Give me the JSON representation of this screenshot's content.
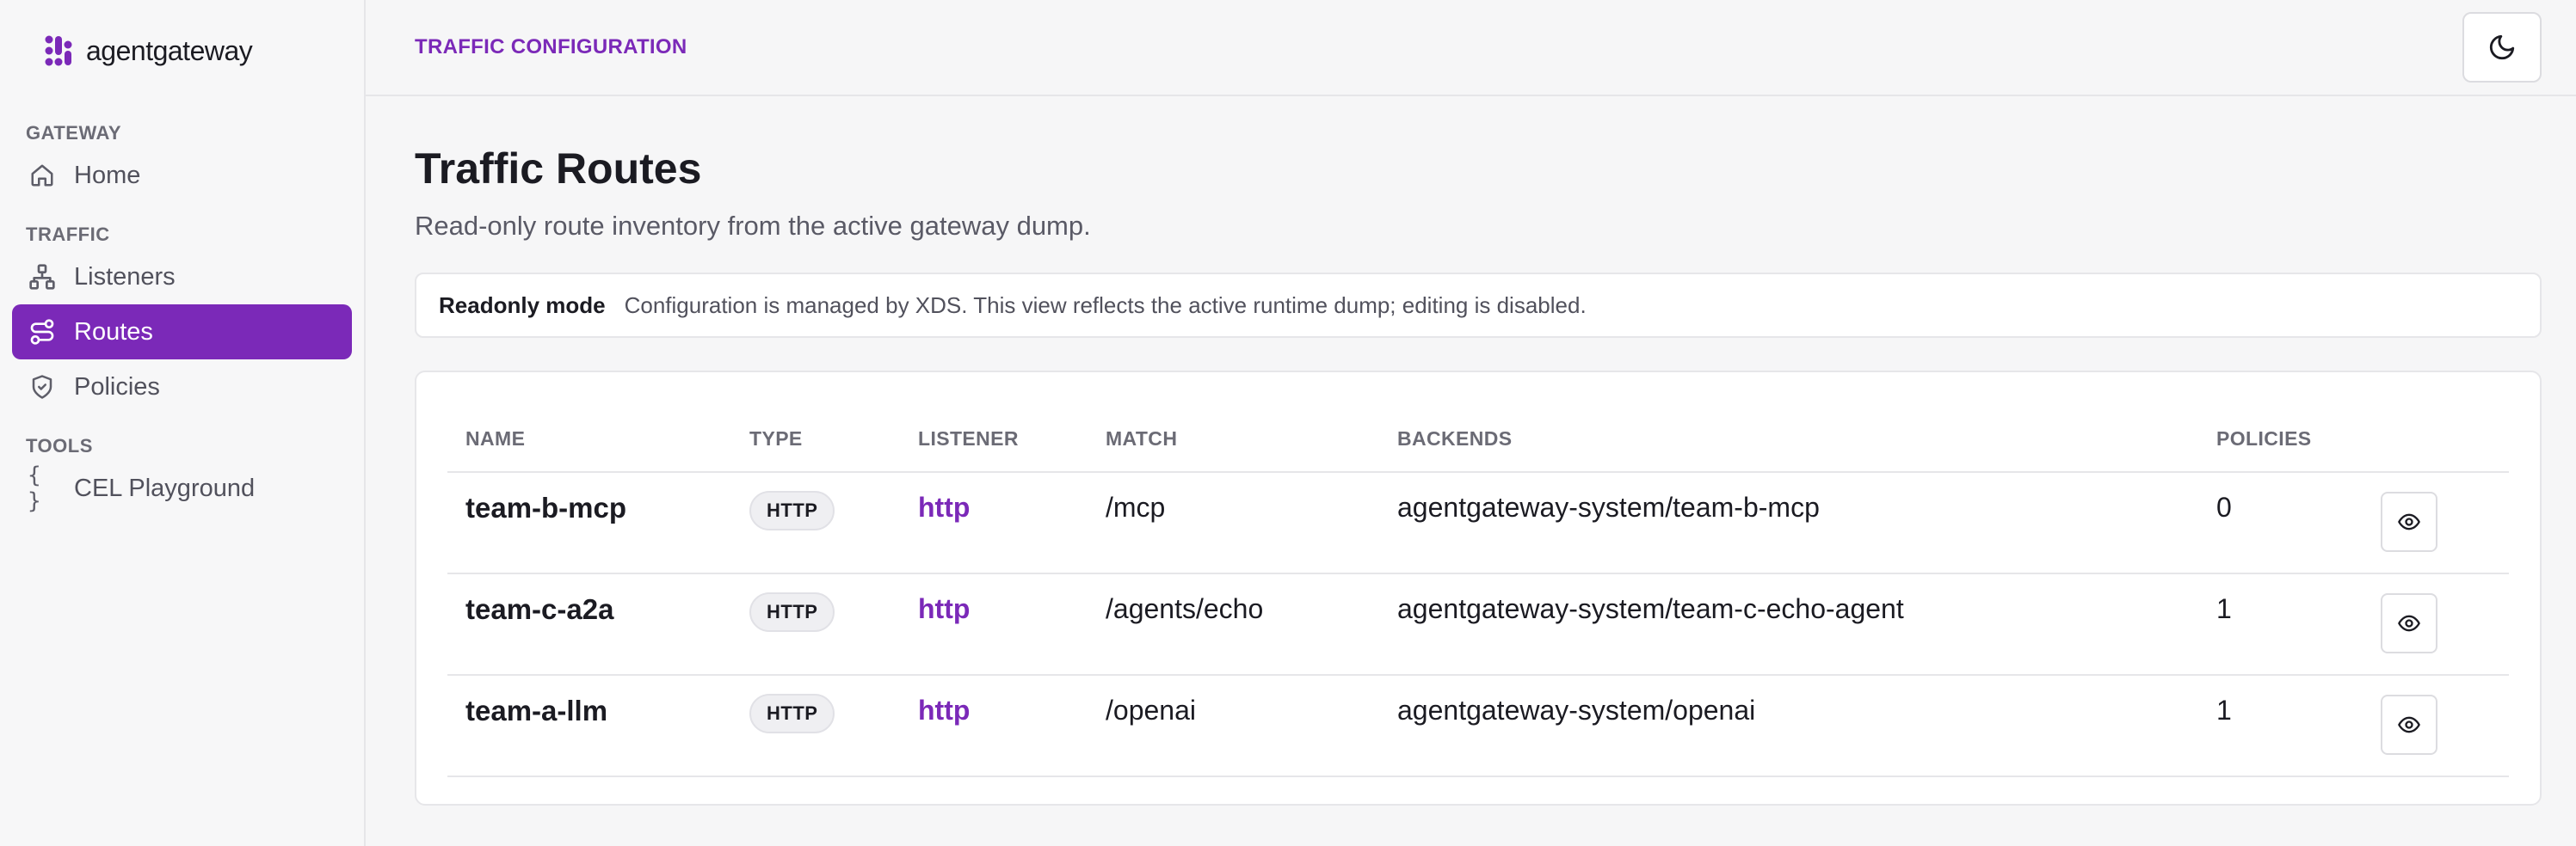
{
  "brand": {
    "name": "agentgateway",
    "accent": "#7b29b8"
  },
  "sidebar": {
    "groups": [
      {
        "label": "GATEWAY",
        "items": [
          {
            "label": "Home",
            "icon": "home-icon"
          }
        ]
      },
      {
        "label": "TRAFFIC",
        "items": [
          {
            "label": "Listeners",
            "icon": "network-icon"
          },
          {
            "label": "Routes",
            "icon": "route-icon",
            "active": true
          },
          {
            "label": "Policies",
            "icon": "shield-check-icon"
          }
        ]
      },
      {
        "label": "TOOLS",
        "items": [
          {
            "label": "CEL Playground",
            "icon": "braces-icon"
          }
        ]
      }
    ]
  },
  "header": {
    "section": "TRAFFIC CONFIGURATION",
    "theme_icon": "moon-icon"
  },
  "page": {
    "title": "Traffic Routes",
    "subtitle": "Read-only route inventory from the active gateway dump."
  },
  "notice": {
    "title": "Readonly mode",
    "text": "Configuration is managed by XDS. This view reflects the active runtime dump; editing is disabled."
  },
  "table": {
    "columns": [
      "NAME",
      "TYPE",
      "LISTENER",
      "MATCH",
      "BACKENDS",
      "POLICIES"
    ],
    "rows": [
      {
        "name": "team-b-mcp",
        "type": "HTTP",
        "listener": "http",
        "match": "/mcp",
        "backends": "agentgateway-system/team-b-mcp",
        "policies": "0"
      },
      {
        "name": "team-c-a2a",
        "type": "HTTP",
        "listener": "http",
        "match": "/agents/echo",
        "backends": "agentgateway-system/team-c-echo-agent",
        "policies": "1"
      },
      {
        "name": "team-a-llm",
        "type": "HTTP",
        "listener": "http",
        "match": "/openai",
        "backends": "agentgateway-system/openai",
        "policies": "1"
      }
    ],
    "row_action_icon": "eye-icon"
  }
}
